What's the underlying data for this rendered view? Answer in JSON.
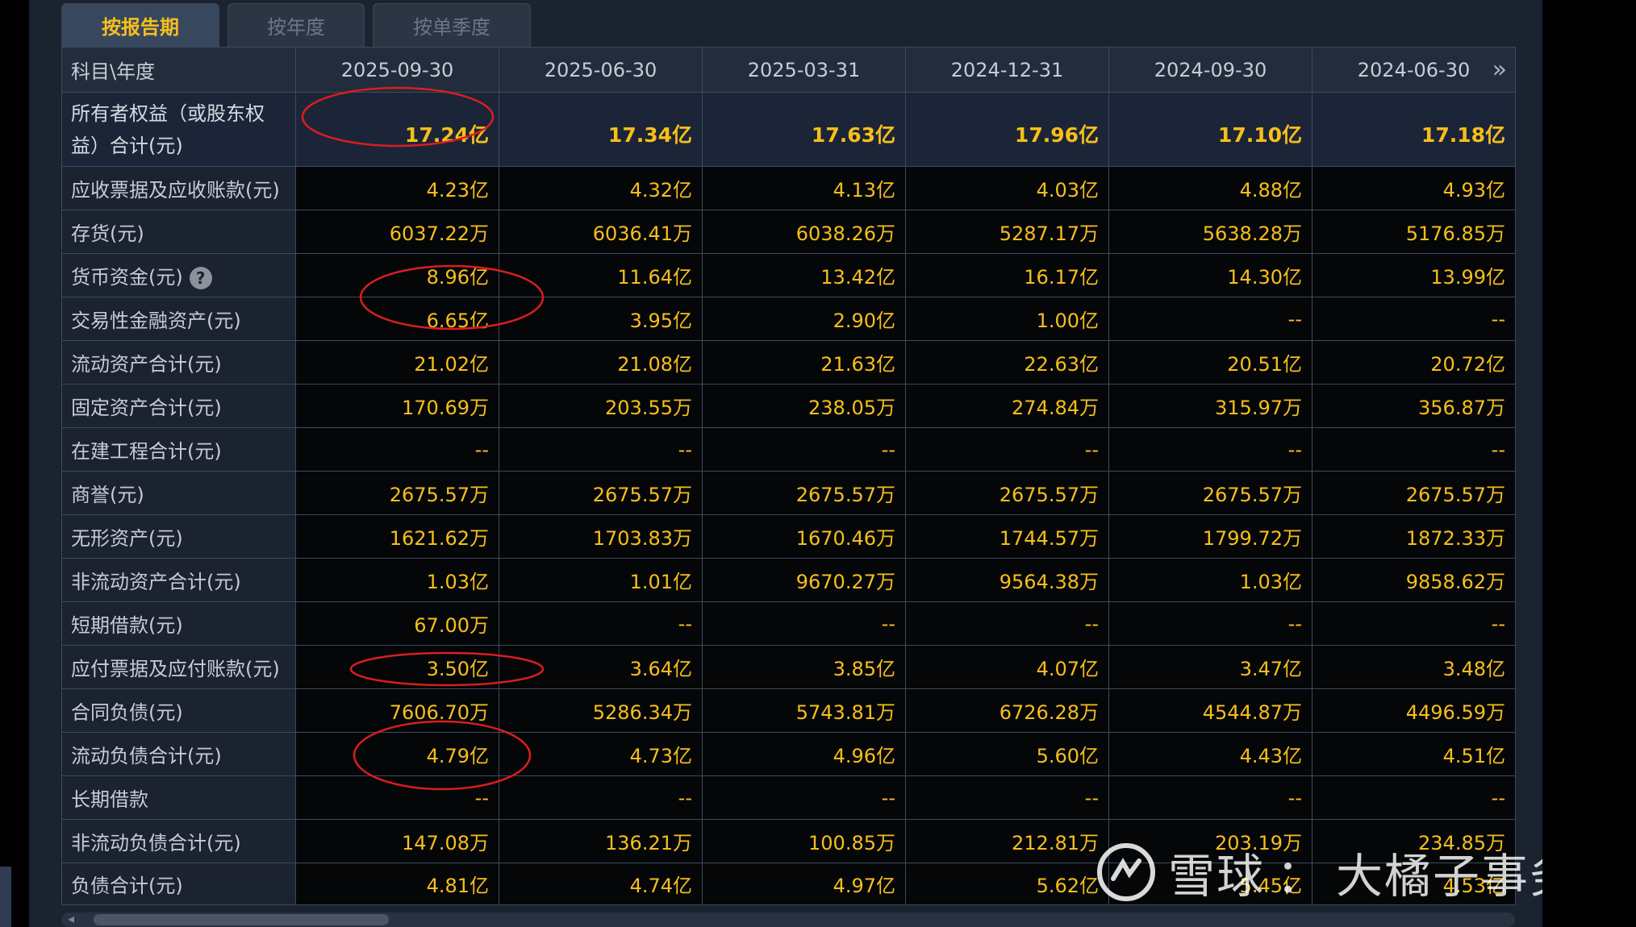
{
  "tabs": [
    "按报告期",
    "按年度",
    "按单季度"
  ],
  "table": {
    "corner": "科目\\年度",
    "dates": [
      "2025-09-30",
      "2025-06-30",
      "2025-03-31",
      "2024-12-31",
      "2024-09-30",
      "2024-06-30"
    ],
    "rows": [
      {
        "label": "所有者权益（或股东权益）合计(元)",
        "values": [
          "17.24亿",
          "17.34亿",
          "17.63亿",
          "17.96亿",
          "17.10亿",
          "17.18亿"
        ]
      },
      {
        "label": "应收票据及应收账款(元)",
        "values": [
          "4.23亿",
          "4.32亿",
          "4.13亿",
          "4.03亿",
          "4.88亿",
          "4.93亿"
        ]
      },
      {
        "label": "存货(元)",
        "values": [
          "6037.22万",
          "6036.41万",
          "6038.26万",
          "5287.17万",
          "5638.28万",
          "5176.85万"
        ]
      },
      {
        "label": "货币资金(元)",
        "values": [
          "8.96亿",
          "11.64亿",
          "13.42亿",
          "16.17亿",
          "14.30亿",
          "13.99亿"
        ]
      },
      {
        "label": "交易性金融资产(元)",
        "values": [
          "6.65亿",
          "3.95亿",
          "2.90亿",
          "1.00亿",
          "--",
          "--"
        ]
      },
      {
        "label": "流动资产合计(元)",
        "values": [
          "21.02亿",
          "21.08亿",
          "21.63亿",
          "22.63亿",
          "20.51亿",
          "20.72亿"
        ]
      },
      {
        "label": "固定资产合计(元)",
        "values": [
          "170.69万",
          "203.55万",
          "238.05万",
          "274.84万",
          "315.97万",
          "356.87万"
        ]
      },
      {
        "label": "在建工程合计(元)",
        "values": [
          "--",
          "--",
          "--",
          "--",
          "--",
          "--"
        ]
      },
      {
        "label": "商誉(元)",
        "values": [
          "2675.57万",
          "2675.57万",
          "2675.57万",
          "2675.57万",
          "2675.57万",
          "2675.57万"
        ]
      },
      {
        "label": "无形资产(元)",
        "values": [
          "1621.62万",
          "1703.83万",
          "1670.46万",
          "1744.57万",
          "1799.72万",
          "1872.33万"
        ]
      },
      {
        "label": "非流动资产合计(元)",
        "values": [
          "1.03亿",
          "1.01亿",
          "9670.27万",
          "9564.38万",
          "1.03亿",
          "9858.62万"
        ]
      },
      {
        "label": "短期借款(元)",
        "values": [
          "67.00万",
          "--",
          "--",
          "--",
          "--",
          "--"
        ]
      },
      {
        "label": "应付票据及应付账款(元)",
        "values": [
          "3.50亿",
          "3.64亿",
          "3.85亿",
          "4.07亿",
          "3.47亿",
          "3.48亿"
        ]
      },
      {
        "label": "合同负债(元)",
        "values": [
          "7606.70万",
          "5286.34万",
          "5743.81万",
          "6726.28万",
          "4544.87万",
          "4496.59万"
        ]
      },
      {
        "label": "流动负债合计(元)",
        "values": [
          "4.79亿",
          "4.73亿",
          "4.96亿",
          "5.60亿",
          "4.43亿",
          "4.51亿"
        ]
      },
      {
        "label": "长期借款",
        "values": [
          "--",
          "--",
          "--",
          "--",
          "--",
          "--"
        ]
      },
      {
        "label": "非流动负债合计(元)",
        "values": [
          "147.08万",
          "136.21万",
          "100.85万",
          "212.81万",
          "203.19万",
          "234.85万"
        ]
      },
      {
        "label": "负债合计(元)",
        "values": [
          "4.81亿",
          "4.74亿",
          "4.97亿",
          "5.62亿",
          "5.45亿",
          "4.53亿"
        ]
      }
    ]
  },
  "help_icon": "question-icon",
  "next_icon": "double-chevron-right-icon",
  "watermark": {
    "brand": "雪球",
    "sep": "：",
    "author": "大橘子事务所"
  },
  "colors": {
    "value": "#f7bf1a",
    "label": "#c6ccd6",
    "annotation": "#d81e1e"
  }
}
